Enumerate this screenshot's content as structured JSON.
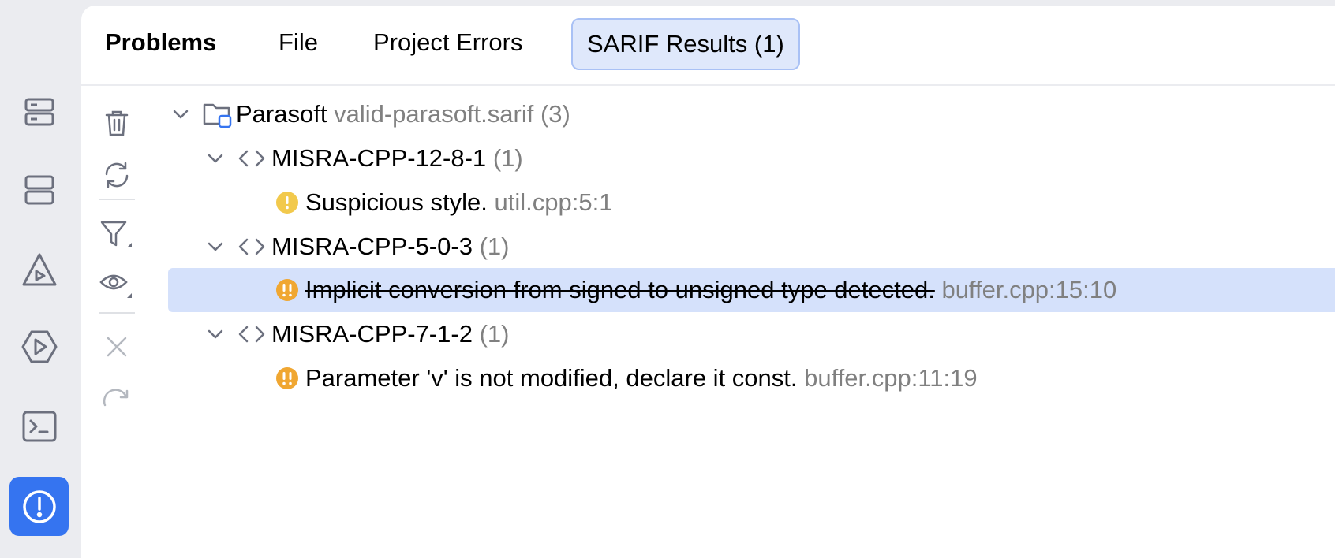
{
  "tool_window": {
    "title": "Problems",
    "tabs": [
      {
        "label": "File"
      },
      {
        "label": "Project Errors"
      },
      {
        "label": "SARIF Results (1)",
        "selected": true
      }
    ]
  },
  "sidebar": {
    "icons": [
      "structure-icon",
      "layers-icon",
      "vcs-icon",
      "run-icon",
      "terminal-icon",
      "problems-icon"
    ],
    "active": "problems-icon"
  },
  "toolbar": {
    "icons": [
      "delete-icon",
      "refresh-icon",
      "filter-icon",
      "view-icon",
      "close-icon",
      "redo-icon"
    ]
  },
  "tree": {
    "root": {
      "name": "Parasoft",
      "file": "valid-parasoft.sarif",
      "count": "(3)"
    },
    "rules": [
      {
        "id": "MISRA-CPP-12-8-1",
        "count": "(1)",
        "problems": [
          {
            "message": "Suspicious style.",
            "location": "util.cpp:5:1",
            "severity": "weak-warning",
            "resolved": false
          }
        ]
      },
      {
        "id": "MISRA-CPP-5-0-3",
        "count": "(1)",
        "problems": [
          {
            "message": "Implicit conversion from signed to unsigned type detected.",
            "location": "buffer.cpp:15:10",
            "severity": "warning",
            "resolved": true,
            "selected": true
          }
        ]
      },
      {
        "id": "MISRA-CPP-7-1-2",
        "count": "(1)",
        "problems": [
          {
            "message": "Parameter 'v' is not modified, declare it const.",
            "location": "buffer.cpp:11:19",
            "severity": "warning",
            "resolved": false
          }
        ]
      }
    ]
  },
  "colors": {
    "accent": "#3574f0",
    "selection": "#d5e1fb",
    "weak_warning": "#f2c94c",
    "warning": "#f0a732",
    "secondary_text": "#808080"
  }
}
